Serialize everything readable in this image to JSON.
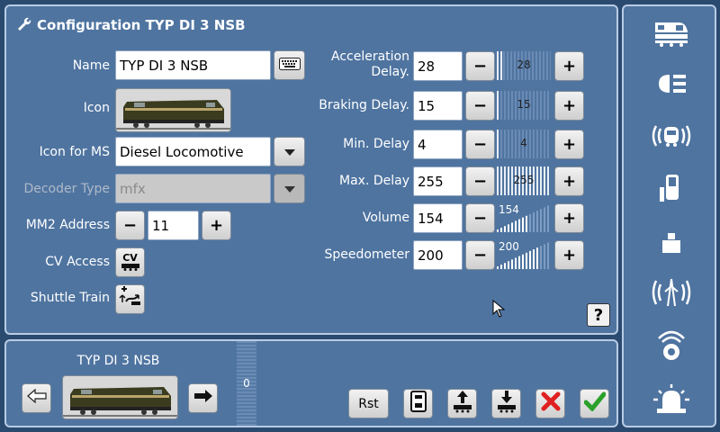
{
  "config": {
    "title": "Configuration TYP DI 3 NSB",
    "name_label": "Name",
    "name_value": "TYP DI 3 NSB",
    "icon_label": "Icon",
    "icon_ms_label": "Icon for MS",
    "icon_ms_value": "Diesel Locomotive",
    "decoder_label": "Decoder Type",
    "decoder_value": "mfx",
    "mm2_label": "MM2 Address",
    "mm2_value": "11",
    "cv_label": "CV Access",
    "cv_button": "CV",
    "shuttle_label": "Shuttle Train"
  },
  "params": [
    {
      "label": "Acceleration Delay.",
      "value": "28",
      "level": 0.11,
      "kind": "bars"
    },
    {
      "label": "Braking Delay.",
      "value": "15",
      "level": 0.06,
      "kind": "bars"
    },
    {
      "label": "Min. Delay",
      "value": "4",
      "level": 0.02,
      "kind": "bars"
    },
    {
      "label": "Max. Delay",
      "value": "255",
      "level": 1.0,
      "kind": "bars"
    },
    {
      "label": "Volume",
      "value": "154",
      "level": 0.6,
      "kind": "ramp"
    },
    {
      "label": "Speedometer",
      "value": "200",
      "level": 0.78,
      "kind": "ramp"
    }
  ],
  "controls": {
    "minus": "−",
    "plus": "+",
    "help": "?"
  },
  "bottom": {
    "loco_name": "TYP DI 3 NSB",
    "speed_value": "0",
    "reset_label": "Rst"
  },
  "sidebar": {
    "icons": [
      "locomotive-icon",
      "headlight-icon",
      "radio-locomotive-icon",
      "signal-icon",
      "weight-icon",
      "broadcast-icon",
      "sound-icon",
      "beacon-icon"
    ]
  },
  "colors": {
    "panel": "#4f74a0",
    "border": "#b8cce4",
    "background": "#2b4a70",
    "cancel": "#e02020",
    "confirm": "#2aa02a"
  }
}
